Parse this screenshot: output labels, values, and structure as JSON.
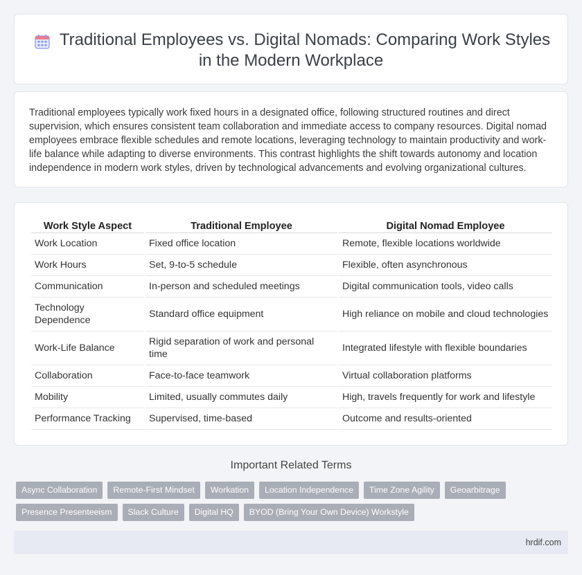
{
  "header": {
    "icon": "calendar-icon",
    "title_line1": "Traditional Employees vs. Digital Nomads: Comparing Work Styles",
    "title_line2": "in the Modern Workplace"
  },
  "intro": {
    "text": "Traditional employees typically work fixed hours in a designated office, following structured routines and direct supervision, which ensures consistent team collaboration and immediate access to company resources. Digital nomad employees embrace flexible schedules and remote locations, leveraging technology to maintain productivity and work-life balance while adapting to diverse environments. This contrast highlights the shift towards autonomy and location independence in modern work styles, driven by technological advancements and evolving organizational cultures."
  },
  "table": {
    "headers": [
      "Work Style Aspect",
      "Traditional Employee",
      "Digital Nomad Employee"
    ],
    "rows": [
      [
        "Work Location",
        "Fixed office location",
        "Remote, flexible locations worldwide"
      ],
      [
        "Work Hours",
        "Set, 9-to-5 schedule",
        "Flexible, often asynchronous"
      ],
      [
        "Communication",
        "In-person and scheduled meetings",
        "Digital communication tools, video calls"
      ],
      [
        "Technology Dependence",
        "Standard office equipment",
        "High reliance on mobile and cloud technologies"
      ],
      [
        "Work-Life Balance",
        "Rigid separation of work and personal time",
        "Integrated lifestyle with flexible boundaries"
      ],
      [
        "Collaboration",
        "Face-to-face teamwork",
        "Virtual collaboration platforms"
      ],
      [
        "Mobility",
        "Limited, usually commutes daily",
        "High, travels frequently for work and lifestyle"
      ],
      [
        "Performance Tracking",
        "Supervised, time-based",
        "Outcome and results-oriented"
      ]
    ]
  },
  "related": {
    "title": "Important Related Terms",
    "tags": [
      "Async Collaboration",
      "Remote-First Mindset",
      "Workation",
      "Location Independence",
      "Time Zone Agility",
      "Geoarbitrage",
      "Presence Presenteeism",
      "Slack Culture",
      "Digital HQ",
      "BYOD (Bring Your Own Device) Workstyle"
    ]
  },
  "footer": {
    "site": "hrdif.com"
  },
  "colors": {
    "tag_bg": "#a9adb6",
    "footer_bg": "#e7eaf3",
    "page_bg": "#f3f4f7"
  }
}
